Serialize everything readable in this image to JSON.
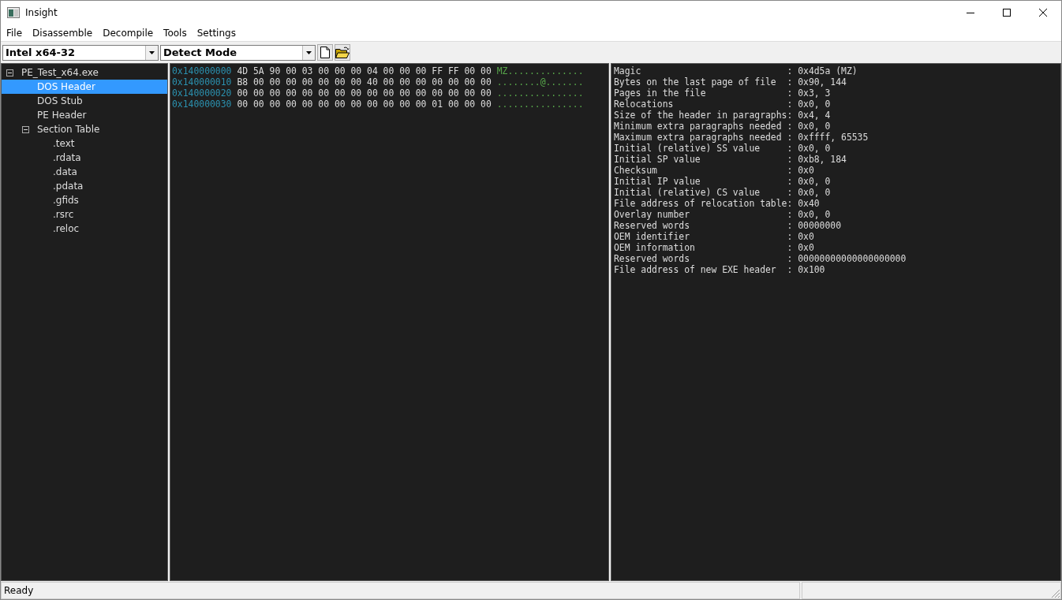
{
  "window": {
    "title": "Insight"
  },
  "menu": [
    "File",
    "Disassemble",
    "Decompile",
    "Tools",
    "Settings"
  ],
  "toolbar": {
    "architecture": "Intel x64-32",
    "mode": "Detect Mode"
  },
  "tree": [
    {
      "label": "PE_Test_x64.exe",
      "expanded": true,
      "selected": false,
      "children": [
        {
          "label": "DOS Header",
          "selected": true
        },
        {
          "label": "DOS Stub",
          "selected": false
        },
        {
          "label": "PE Header",
          "selected": false
        },
        {
          "label": "Section Table",
          "expanded": true,
          "selected": false,
          "children": [
            {
              "label": ".text",
              "selected": false
            },
            {
              "label": ".rdata",
              "selected": false
            },
            {
              "label": ".data",
              "selected": false
            },
            {
              "label": ".pdata",
              "selected": false
            },
            {
              "label": ".gfids",
              "selected": false
            },
            {
              "label": ".rsrc",
              "selected": false
            },
            {
              "label": ".reloc",
              "selected": false
            }
          ]
        }
      ]
    }
  ],
  "hex_rows": [
    {
      "address": "0x140000000",
      "bytes": "4D 5A 90 00 03 00 00 00 04 00 00 00 FF FF 00 00",
      "ascii": "MZ.............."
    },
    {
      "address": "0x140000010",
      "bytes": "B8 00 00 00 00 00 00 00 40 00 00 00 00 00 00 00",
      "ascii": "........@......."
    },
    {
      "address": "0x140000020",
      "bytes": "00 00 00 00 00 00 00 00 00 00 00 00 00 00 00 00",
      "ascii": "................"
    },
    {
      "address": "0x140000030",
      "bytes": "00 00 00 00 00 00 00 00 00 00 00 00 01 00 00 00",
      "ascii": "................"
    }
  ],
  "info_lines": [
    "Magic                           : 0x4d5a (MZ)",
    "Bytes on the last page of file  : 0x90, 144",
    "Pages in the file               : 0x3, 3",
    "Relocations                     : 0x0, 0",
    "Size of the header in paragraphs: 0x4, 4",
    "Minimum extra paragraphs needed : 0x0, 0",
    "Maximum extra paragraphs needed : 0xffff, 65535",
    "Initial (relative) SS value     : 0x0, 0",
    "Initial SP value                : 0xb8, 184",
    "Checksum                        : 0x0",
    "Initial IP value                : 0x0, 0",
    "Initial (relative) CS value     : 0x0, 0",
    "File address of relocation table: 0x40",
    "Overlay number                  : 0x0, 0",
    "Reserved words                  : 00000000",
    "OEM identifier                  : 0x0",
    "OEM information                 : 0x0",
    "Reserved words                  : 00000000000000000000",
    "File address of new EXE header  : 0x100"
  ],
  "status_bar": {
    "text": "Ready"
  }
}
